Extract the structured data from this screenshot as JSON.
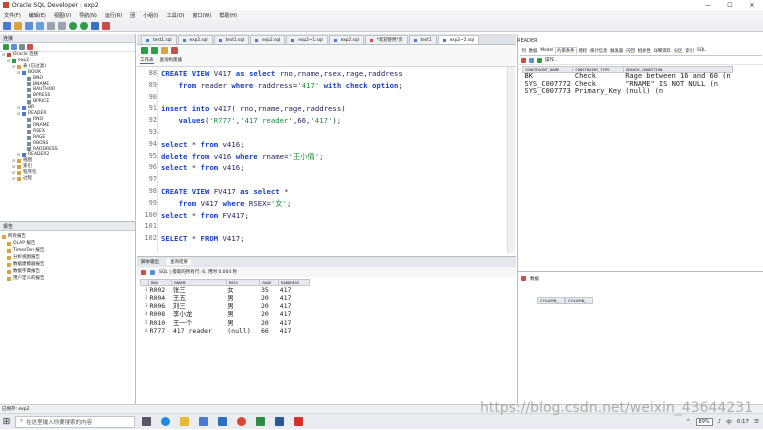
{
  "window": {
    "title": "Oracle SQL Developer : exp2",
    "min": "—",
    "max": "☐",
    "close": "✕"
  },
  "menu": [
    "文件(F)",
    "编辑(E)",
    "视图(V)",
    "导航(N)",
    "运行(R)",
    "团",
    "小组(I)",
    "工具(O)",
    "窗口(W)",
    "帮助(H)"
  ],
  "connections": {
    "header": "连接",
    "tree": [
      {
        "label": "Oracle 连接",
        "indent": 0
      },
      {
        "label": "exp2",
        "indent": 1
      },
      {
        "label": "表 (已过滤)",
        "indent": 2
      },
      {
        "label": "BOOK",
        "indent": 3
      },
      {
        "label": "BNO",
        "indent": 4
      },
      {
        "label": "BNAME",
        "indent": 4
      },
      {
        "label": "BAUTHOR",
        "indent": 4
      },
      {
        "label": "BPRESS",
        "indent": 4
      },
      {
        "label": "BPRICE",
        "indent": 4
      },
      {
        "label": "BR",
        "indent": 3
      },
      {
        "label": "READER",
        "indent": 3
      },
      {
        "label": "RNO",
        "indent": 4
      },
      {
        "label": "RNAME",
        "indent": 4
      },
      {
        "label": "RSEX",
        "indent": 4
      },
      {
        "label": "RAGE",
        "indent": 4
      },
      {
        "label": "RBOSS",
        "indent": 4
      },
      {
        "label": "RADDRESS",
        "indent": 4
      },
      {
        "label": "READER2",
        "indent": 3
      },
      {
        "label": "视图",
        "indent": 2
      },
      {
        "label": "索引",
        "indent": 2
      },
      {
        "label": "程序包",
        "indent": 2
      },
      {
        "label": "过程",
        "indent": 2
      }
    ]
  },
  "reports": {
    "header": "报告",
    "items": [
      "所有报告",
      "OLAP 报告",
      "TimesTen 报告",
      "分析视图报告",
      "数据建模器报告",
      "数据字典报告",
      "用户定义的报告"
    ]
  },
  "doc_tabs": [
    "test1.sql",
    "exp2.sql",
    "test1.sql",
    "exp2.sql",
    "exp2~1.sql",
    "exp2.sql",
    "*欢迎使用*页",
    "test1",
    "exp2~2.sql"
  ],
  "worksheet_tabs": [
    "工作表",
    "查询构建器"
  ],
  "editor": {
    "lines": [
      {
        "n": "88",
        "t": "CREATE VIEW V417 as select rno,rname,rsex,rage,raddress"
      },
      {
        "n": "89",
        "t": "    from reader where raddress='417' with check option;"
      },
      {
        "n": "90",
        "t": ""
      },
      {
        "n": "91",
        "t": "insert into v417( rno,rname,rage,raddress)"
      },
      {
        "n": "92",
        "t": "    values('R777','417 reader',66,'417');"
      },
      {
        "n": "93",
        "t": ""
      },
      {
        "n": "94",
        "t": "select * from v416;"
      },
      {
        "n": "95",
        "t": "delete from v416 where rname='王小倩';"
      },
      {
        "n": "96",
        "t": "select * from v416;"
      },
      {
        "n": "97",
        "t": ""
      },
      {
        "n": "98",
        "t": "CREATE VIEW FV417 as select *"
      },
      {
        "n": "99",
        "t": "    from V417 where RSEX='女';"
      },
      {
        "n": "100",
        "t": "select * from FV417;"
      },
      {
        "n": "101",
        "t": ""
      },
      {
        "n": "102",
        "t": "SELECT * FROM V417;"
      }
    ]
  },
  "results": {
    "tabs": [
      "脚本输出",
      "查询结果"
    ],
    "info": "SQL | 提取的所有行: 6, 用时 0.004 秒",
    "columns": [
      "RNO",
      "RNAME",
      "RSEX",
      "RAGE",
      "RADDRESS"
    ],
    "rows": [
      [
        "1",
        "R002",
        "张三",
        "女",
        "35",
        "417"
      ],
      [
        "2",
        "R004",
        "王五",
        "男",
        "20",
        "417"
      ],
      [
        "3",
        "R006",
        "刘三",
        "男",
        "20",
        "417"
      ],
      [
        "4",
        "R008",
        "李小龙",
        "男",
        "20",
        "417"
      ],
      [
        "5",
        "R010",
        "王一个",
        "男",
        "20",
        "417"
      ],
      [
        "6",
        "R777",
        "417 reader",
        "(null)",
        "66",
        "417"
      ]
    ]
  },
  "right_panel": {
    "title": "READER",
    "tabs": [
      "列",
      "数据",
      "Model",
      "约束条件",
      "授权",
      "统计信息",
      "触发器",
      "闪回",
      "相关性",
      "详细资料",
      "分区",
      "索引",
      "SQL"
    ],
    "actions_label": "操作...",
    "columns": [
      "CONSTRAINT_NAME",
      "CONSTRAINT_TYPE",
      "SEARCH_CONDITION"
    ],
    "rows": [
      [
        "BK",
        "Check",
        "Rage between 16 and 60 (n"
      ],
      [
        "SYS_C007772",
        "Check",
        "\"RNAME\" IS NOT NULL  (n"
      ],
      [
        "SYS_C007773",
        "Primary_Key",
        "(null)  (n"
      ]
    ],
    "lower_tab": "数据",
    "lower_columns": [
      "COLUMN_",
      "COLUMN_"
    ]
  },
  "status": {
    "text": "已保存: exp2"
  },
  "taskbar": {
    "search_placeholder": "在这里输入你要搜索的内容",
    "battery": "89%",
    "time": "0:17",
    "lang": "中"
  },
  "watermark": "https://blog.csdn.net/weixin_43644231",
  "colors": {
    "keyword": "#1a3fc7",
    "string": "#1a8a3a",
    "current_line": "#fff8d8"
  }
}
